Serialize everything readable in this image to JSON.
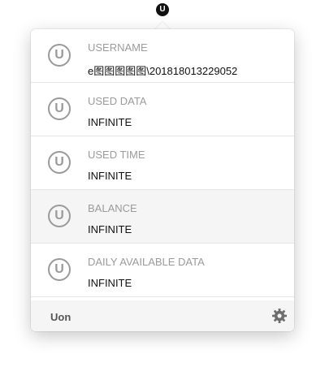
{
  "menubar": {
    "icon": "u-logo-icon",
    "letter": "U"
  },
  "rows": [
    {
      "label": "USERNAME",
      "value": "e图图图图图\\201818013229052",
      "icon": "u-badge-icon",
      "letter": "U"
    },
    {
      "label": "USED DATA",
      "value": "INFINITE",
      "icon": "u-badge-icon",
      "letter": "U"
    },
    {
      "label": "USED TIME",
      "value": "INFINITE",
      "icon": "u-badge-icon",
      "letter": "U"
    },
    {
      "label": "BALANCE",
      "value": "INFINITE",
      "icon": "u-badge-icon",
      "letter": "U"
    },
    {
      "label": "DAILY AVAILABLE DATA",
      "value": "INFINITE",
      "icon": "u-badge-icon",
      "letter": "U"
    }
  ],
  "footer": {
    "app_name": "Uon",
    "settings_icon": "gear-icon"
  },
  "colors": {
    "label_gray": "#9b9b9b",
    "icon_gray": "#9a9a9a",
    "highlight_bg": "#f5f5f5"
  }
}
